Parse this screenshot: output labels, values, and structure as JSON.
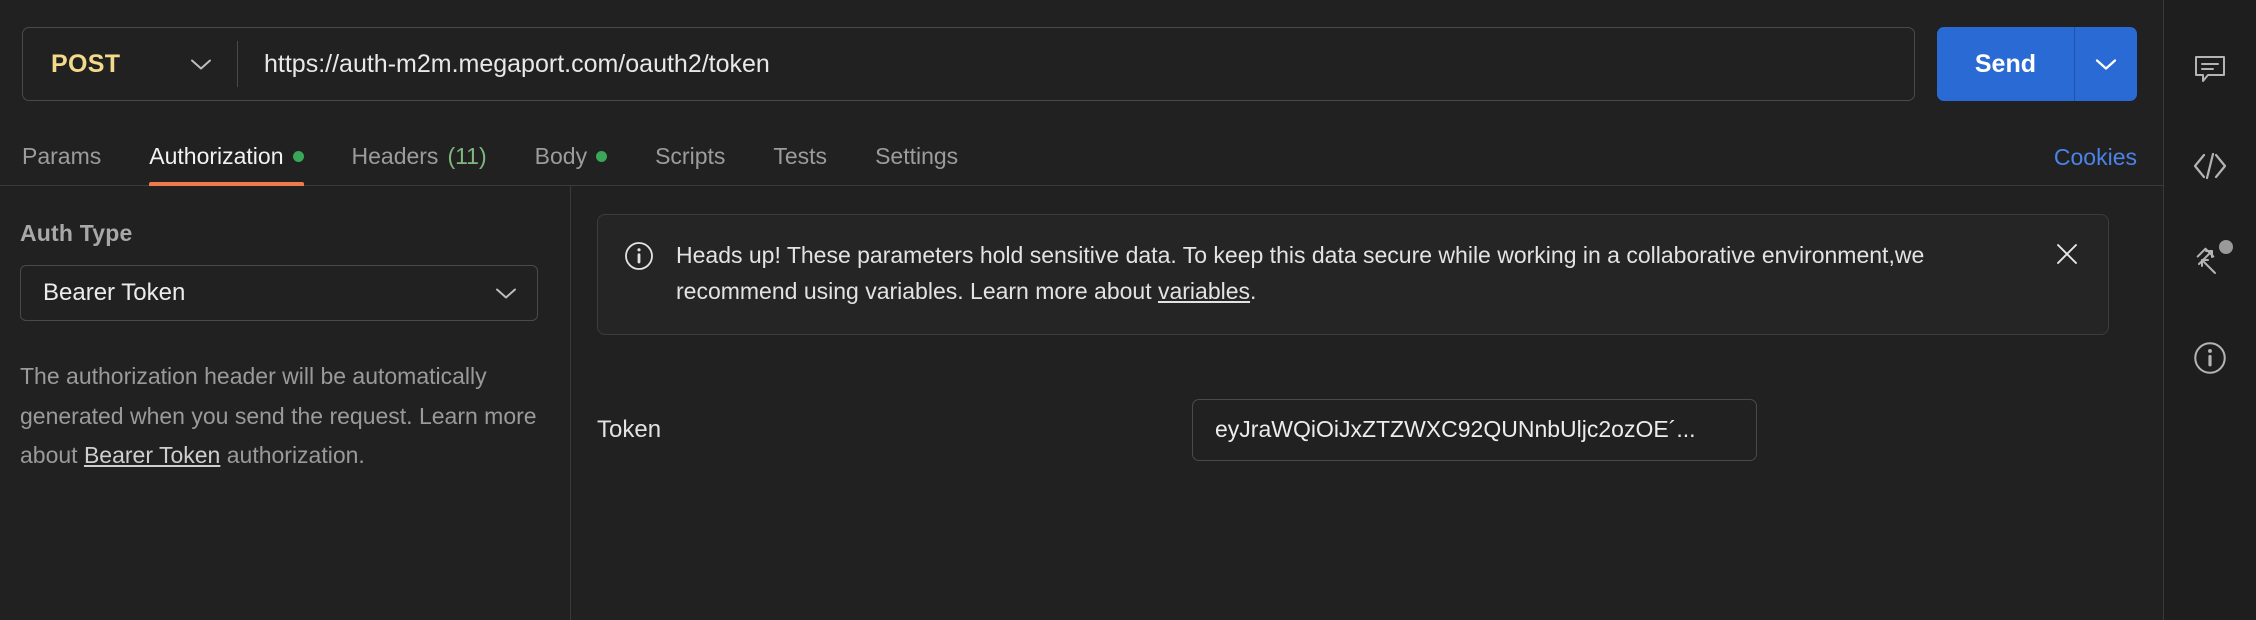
{
  "request": {
    "method": "POST",
    "url": "https://auth-m2m.megaport.com/oauth2/token",
    "send_label": "Send",
    "method_caret_icon": "chevron-down-icon",
    "send_caret_icon": "chevron-down-icon"
  },
  "tabs": [
    {
      "label": "Params",
      "active": false,
      "dot": false,
      "count": ""
    },
    {
      "label": "Authorization",
      "active": true,
      "dot": true,
      "count": ""
    },
    {
      "label": "Headers",
      "active": false,
      "dot": false,
      "count": "(11)"
    },
    {
      "label": "Body",
      "active": false,
      "dot": true,
      "count": ""
    },
    {
      "label": "Scripts",
      "active": false,
      "dot": false,
      "count": ""
    },
    {
      "label": "Tests",
      "active": false,
      "dot": false,
      "count": ""
    },
    {
      "label": "Settings",
      "active": false,
      "dot": false,
      "count": ""
    }
  ],
  "cookies_label": "Cookies",
  "auth": {
    "type_label": "Auth Type",
    "type_value": "Bearer Token",
    "type_caret_icon": "chevron-down-icon",
    "helper_before": "The authorization header will be automatically generated when you send the request. Learn more about ",
    "helper_link": "Bearer Token",
    "helper_after": " authorization."
  },
  "banner": {
    "icon": "info-circle-icon",
    "text_before": "Heads up! These parameters hold sensitive data. To keep this data secure while working in a collaborative environment,we recommend using variables. Learn more about ",
    "link": "variables",
    "text_after": ".",
    "close_icon": "close-icon"
  },
  "token": {
    "label": "Token",
    "value": "eyJraWQiOiJxZTZWXC92QUNnbUljc2ozOE´...",
    "placeholder": "Token"
  },
  "rail": [
    {
      "icon": "comment-icon",
      "badge": false
    },
    {
      "icon": "code-icon",
      "badge": false
    },
    {
      "icon": "mock-arrows-icon",
      "badge": true
    },
    {
      "icon": "info-circle-icon",
      "badge": false
    }
  ],
  "colors": {
    "background": "#212121",
    "rail_background": "#1e1e1e",
    "accent_send": "#2a6ad4",
    "accent_tab_underline": "#ef7b4d",
    "method_post": "#f3d98a",
    "dot_green": "#3aa657",
    "link_blue": "#4b83e8",
    "border": "#3a3a3a"
  }
}
